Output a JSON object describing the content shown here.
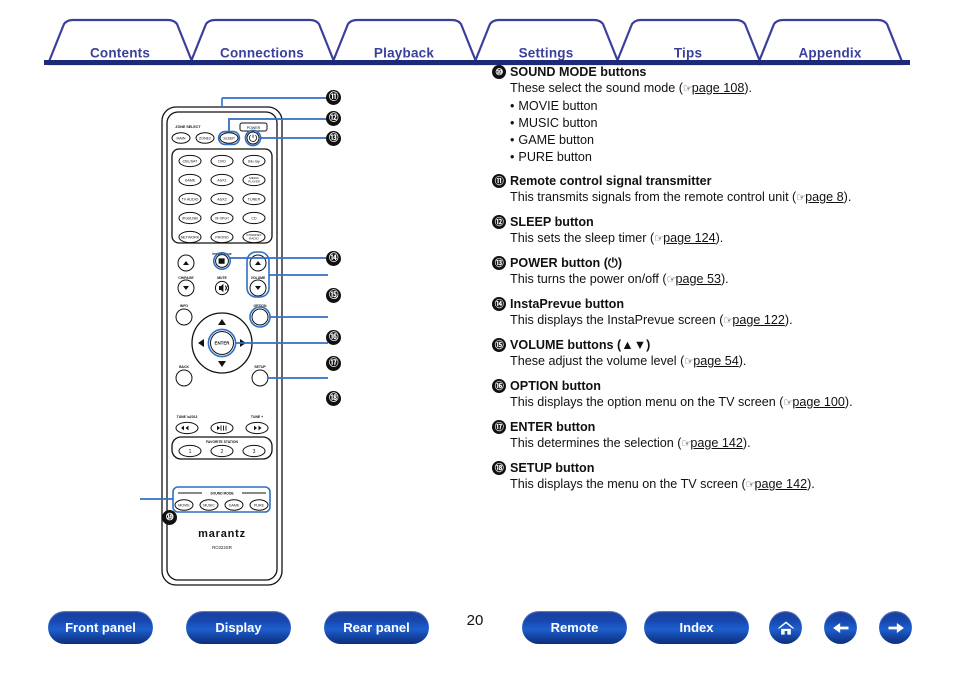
{
  "tabs": [
    {
      "label": "Contents"
    },
    {
      "label": "Connections"
    },
    {
      "label": "Playback"
    },
    {
      "label": "Settings"
    },
    {
      "label": "Tips"
    },
    {
      "label": "Appendix"
    }
  ],
  "callouts": [
    {
      "num": "⑩",
      "id": "10"
    },
    {
      "num": "⑪",
      "id": "11"
    },
    {
      "num": "⑫",
      "id": "12"
    },
    {
      "num": "⑬",
      "id": "13"
    },
    {
      "num": "⑭",
      "id": "14"
    },
    {
      "num": "⑮",
      "id": "15"
    },
    {
      "num": "⑯",
      "id": "16"
    },
    {
      "num": "⑰",
      "id": "17"
    },
    {
      "num": "⑱",
      "id": "18"
    }
  ],
  "items": [
    {
      "num": "10",
      "title": "SOUND MODE buttons",
      "body_pre": "These select the sound mode (",
      "ref_page": "page 108",
      "body_post": ").",
      "bullets": [
        "MOVIE button",
        "MUSIC button",
        "GAME button",
        "PURE button"
      ]
    },
    {
      "num": "11",
      "title": "Remote control signal transmitter",
      "body_pre": "This transmits signals from the remote control unit (",
      "ref_page": "page 8",
      "body_post": ")."
    },
    {
      "num": "12",
      "title": "SLEEP button",
      "body_pre": "This sets the sleep timer (",
      "ref_page": "page 124",
      "body_post": ")."
    },
    {
      "num": "13",
      "title": "POWER button (⏻)",
      "body_pre": "This turns the power on/off (",
      "ref_page": "page 53",
      "body_post": ")."
    },
    {
      "num": "14",
      "title": "InstaPrevue button",
      "body_pre": "This displays the InstaPrevue screen (",
      "ref_page": "page 122",
      "body_post": ")."
    },
    {
      "num": "15",
      "title": "VOLUME buttons (▲▼)",
      "body_pre": "These adjust the volume level (",
      "ref_page": "page 54",
      "body_post": ")."
    },
    {
      "num": "16",
      "title": "OPTION button",
      "body_pre": "This displays the option menu on the TV screen (",
      "ref_page": "page 100",
      "body_post": ")."
    },
    {
      "num": "17",
      "title": "ENTER button",
      "body_pre": "This determines the selection (",
      "ref_page": "page 142",
      "body_post": ")."
    },
    {
      "num": "18",
      "title": "SETUP button",
      "body_pre": "This displays the menu on the TV screen (",
      "ref_page": "page 142",
      "body_post": ")."
    }
  ],
  "remote": {
    "zone_select_label": "ZONE SELECT",
    "power_label": "POWER",
    "zone_buttons": [
      "MAIN",
      "ZONE2",
      "SLEEP"
    ],
    "source_buttons": [
      "CBL/SAT",
      "DVD",
      "Blu-ray",
      "GAME",
      "AUX1",
      "MEDIA PLAYER",
      "TV AUDIO",
      "AUX2",
      "TUNER",
      "iPod/USB",
      "M-XPort",
      "CD",
      "NETWORK",
      "PHONO",
      "INTERNET RADIO"
    ],
    "chpage_label": "CH/PAGE",
    "instaprevue_label": "InstaPrevue",
    "mute_label": "MUTE",
    "volume_label": "VOLUME",
    "info_label": "INFO",
    "option_label": "OPTION",
    "enter_label": "ENTER",
    "back_label": "BACK",
    "setup_label": "SETUP",
    "tune_minus_label": "TUNE –",
    "tune_plus_label": "TUNE +",
    "favorite_label": "FAVORITE STATION",
    "favorite_buttons": [
      "1",
      "2",
      "3"
    ],
    "sound_mode_label": "SOUND MODE",
    "sound_mode_buttons": [
      "MOVIE",
      "MUSIC",
      "GAME",
      "PURE"
    ],
    "brand": "marantz",
    "model": "RC022SR"
  },
  "bottom": {
    "page_number": "20",
    "buttons": [
      {
        "label": "Front panel"
      },
      {
        "label": "Display"
      },
      {
        "label": "Rear panel"
      },
      {
        "label": "Remote"
      },
      {
        "label": "Index"
      }
    ],
    "icons": [
      {
        "name": "home-icon"
      },
      {
        "name": "back-arrow-icon"
      },
      {
        "name": "forward-arrow-icon"
      }
    ]
  },
  "colors": {
    "tab_text": "#3a3f9c",
    "tab_border": "#3a3f9c",
    "rule": "#1d2a78",
    "button_blue": "#1746ad",
    "callout_bg": "#101010",
    "leader_line": "#2f6fc4"
  }
}
